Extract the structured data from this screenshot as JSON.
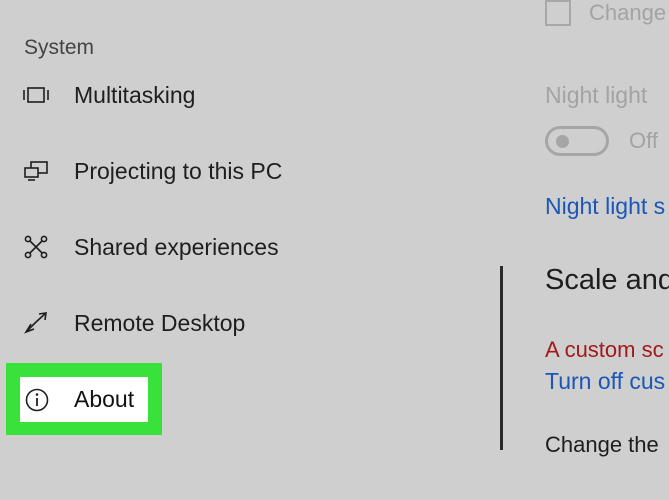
{
  "sidebar": {
    "section_title": "System",
    "items": [
      {
        "label": "Multitasking",
        "icon": "multitasking-icon"
      },
      {
        "label": "Projecting to this PC",
        "icon": "projecting-icon"
      },
      {
        "label": "Shared experiences",
        "icon": "shared-experiences-icon"
      },
      {
        "label": "Remote Desktop",
        "icon": "remote-desktop-icon"
      },
      {
        "label": "About",
        "icon": "info-icon"
      }
    ],
    "highlight_color": "#39e13b"
  },
  "content": {
    "checkbox_label": "Change",
    "checkbox_checked": false,
    "night_light_heading": "Night light",
    "toggle_label": "Off",
    "toggle_on": false,
    "night_light_settings_link": "Night light s",
    "scale_heading": "Scale and",
    "custom_scale_warning": "A custom sc",
    "turn_off_custom_link": "Turn off cus",
    "change_text": "Change the",
    "link_color": "#1a57b8",
    "warning_color": "#a31a1a"
  }
}
